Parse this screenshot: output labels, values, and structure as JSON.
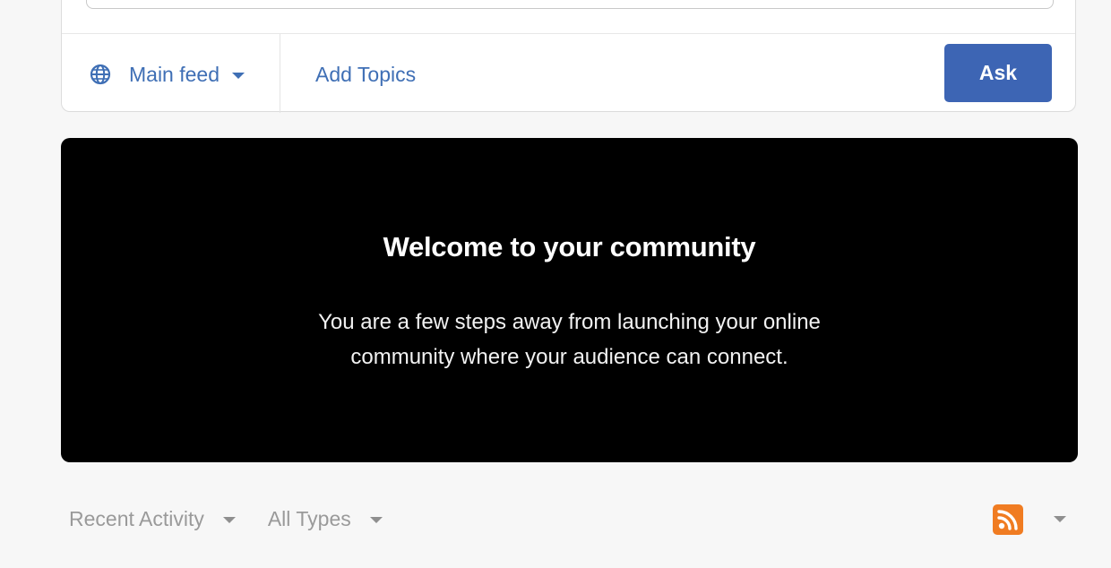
{
  "composer": {
    "feed_label": "Main feed",
    "feed_icon": "globe-icon",
    "add_topics_label": "Add Topics",
    "ask_label": "Ask",
    "accent_color": "#3d65b4"
  },
  "welcome": {
    "title": "Welcome to your community",
    "line1": "You are a few steps away from launching your online",
    "line2": "community where your audience can connect."
  },
  "activity": {
    "sort_label": "Recent Activity",
    "type_label": "All Types",
    "rss_icon": "rss-icon",
    "rss_color": "#f07c22"
  }
}
